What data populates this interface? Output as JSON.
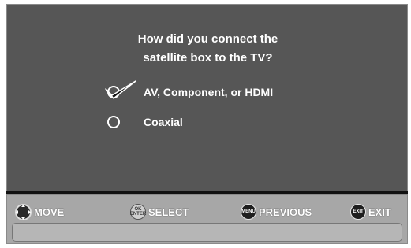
{
  "question": {
    "line1": "How did you connect the",
    "line2": "satellite box to the TV?"
  },
  "options": [
    {
      "label": "AV, Component, or HDMI",
      "selected": true
    },
    {
      "label": "Coaxial",
      "selected": false
    }
  ],
  "footer": {
    "move": {
      "label": "MOVE",
      "icon": "dpad-icon"
    },
    "select": {
      "label": "SELECT",
      "icon": "ok-enter-button-icon",
      "key_top": "OK",
      "key_bottom": "ENTER"
    },
    "previous": {
      "label": "PREVIOUS",
      "icon": "menu-button-icon",
      "key_text": "MENU"
    },
    "exit": {
      "label": "EXIT",
      "icon": "exit-button-icon",
      "key_text": "EXIT"
    }
  },
  "colors": {
    "panel": "#565656",
    "footer": "#a7a7a7",
    "text": "#ffffff"
  }
}
